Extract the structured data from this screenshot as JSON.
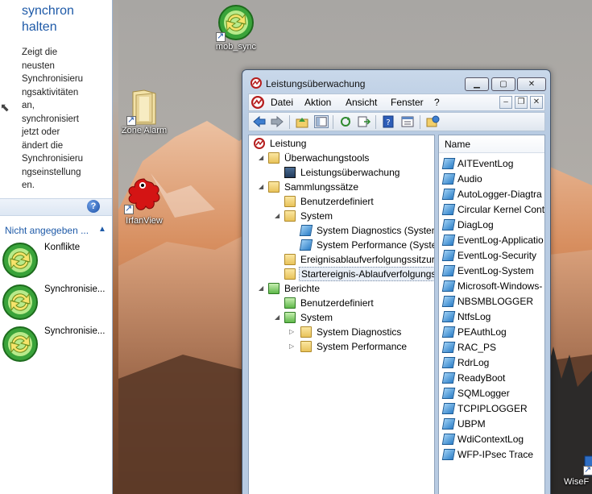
{
  "left_panel": {
    "title_line1": "synchron",
    "title_line2": "halten",
    "description_lines": [
      "Zeigt die",
      "neusten",
      "Synchronisieru",
      "ngsaktivitäten",
      "an,",
      "synchronisiert",
      "jetzt oder",
      "ändert die",
      "Synchronisieru",
      "ngseinstellung",
      "en."
    ],
    "help_label": "?",
    "group_header": "Nicht angegeben ...",
    "items": [
      {
        "label": "Konflikte"
      },
      {
        "label": "Synchronisie..."
      },
      {
        "label": "Synchronisie..."
      }
    ]
  },
  "desktop_icons": [
    {
      "label": "mob_sync"
    },
    {
      "label": "Zone Alarm"
    },
    {
      "label": "IrfanView"
    },
    {
      "label": "WiseF"
    }
  ],
  "window": {
    "title": "Leistungsüberwachung",
    "minimize_label": "▁",
    "maximize_label": "▢",
    "close_label": "✕",
    "menu": [
      "Datei",
      "Aktion",
      "Ansicht",
      "Fenster",
      "?"
    ],
    "mdi_minimize": "–",
    "mdi_restore": "❐",
    "mdi_close": "✕",
    "tree": [
      {
        "label": "Leistung",
        "level": 0,
        "twisty": "",
        "icon": "perf-icon"
      },
      {
        "label": "Überwachungstools",
        "level": 1,
        "twisty": "◢",
        "icon": "folder-icon"
      },
      {
        "label": "Leistungsüberwachung",
        "level": 2,
        "twisty": "",
        "icon": "monitor-icon"
      },
      {
        "label": "Sammlungssätze",
        "level": 1,
        "twisty": "◢",
        "icon": "folder-icon"
      },
      {
        "label": "Benutzerdefiniert",
        "level": 2,
        "twisty": "",
        "icon": "user-folder-icon"
      },
      {
        "label": "System",
        "level": 2,
        "twisty": "◢",
        "icon": "system-folder-icon"
      },
      {
        "label": "System Diagnostics (System",
        "level": 3,
        "twisty": "",
        "icon": "trace-icon"
      },
      {
        "label": "System Performance (Syster",
        "level": 3,
        "twisty": "",
        "icon": "trace-icon"
      },
      {
        "label": "Ereignisablaufverfolgungssitzur",
        "level": 2,
        "twisty": "",
        "icon": "event-folder-icon"
      },
      {
        "label": "Startereignis-Ablaufverfolgungs",
        "level": 2,
        "twisty": "",
        "icon": "event-folder-icon",
        "selected": true
      },
      {
        "label": "Berichte",
        "level": 1,
        "twisty": "◢",
        "icon": "report-folder-icon"
      },
      {
        "label": "Benutzerdefiniert",
        "level": 2,
        "twisty": "",
        "icon": "report-user-icon"
      },
      {
        "label": "System",
        "level": 2,
        "twisty": "◢",
        "icon": "report-system-icon"
      },
      {
        "label": "System Diagnostics",
        "level": 3,
        "twisty": "▷",
        "icon": "report-folder-icon"
      },
      {
        "label": "System Performance",
        "level": 3,
        "twisty": "▷",
        "icon": "report-folder-icon"
      }
    ],
    "list_header": "Name",
    "list_items": [
      "AITEventLog",
      "Audio",
      "AutoLogger-Diagtra",
      "Circular Kernel Cont",
      "DiagLog",
      "EventLog-Applicatio",
      "EventLog-Security",
      "EventLog-System",
      "Microsoft-Windows-",
      "NBSMBLOGGER",
      "NtfsLog",
      "PEAuthLog",
      "RAC_PS",
      "RdrLog",
      "ReadyBoot",
      "SQMLogger",
      "TCPIPLOGGER",
      "UBPM",
      "WdiContextLog",
      "WFP-IPsec Trace"
    ]
  },
  "colors": {
    "accent": "#1e5aa8",
    "window_frame": "#b8cbe2"
  }
}
